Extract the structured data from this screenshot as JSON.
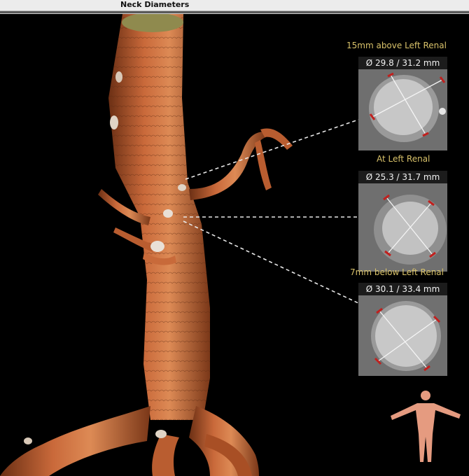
{
  "window": {
    "title": "Neck Diameters"
  },
  "measurements": [
    {
      "label": "15mm above Left Renal",
      "readout": "Ø 29.8 / 31.2 mm"
    },
    {
      "label": "At Left Renal",
      "readout": "Ø 25.3 / 31.7 mm"
    },
    {
      "label": "7mm below Left Renal",
      "readout": "Ø 30.1 / 33.4 mm"
    }
  ],
  "icons": {
    "orientation": "body-orientation-figure-icon"
  },
  "colors": {
    "label": "#d9c26a",
    "vessel": "#c9693a",
    "caliper_end": "#c0201e"
  }
}
